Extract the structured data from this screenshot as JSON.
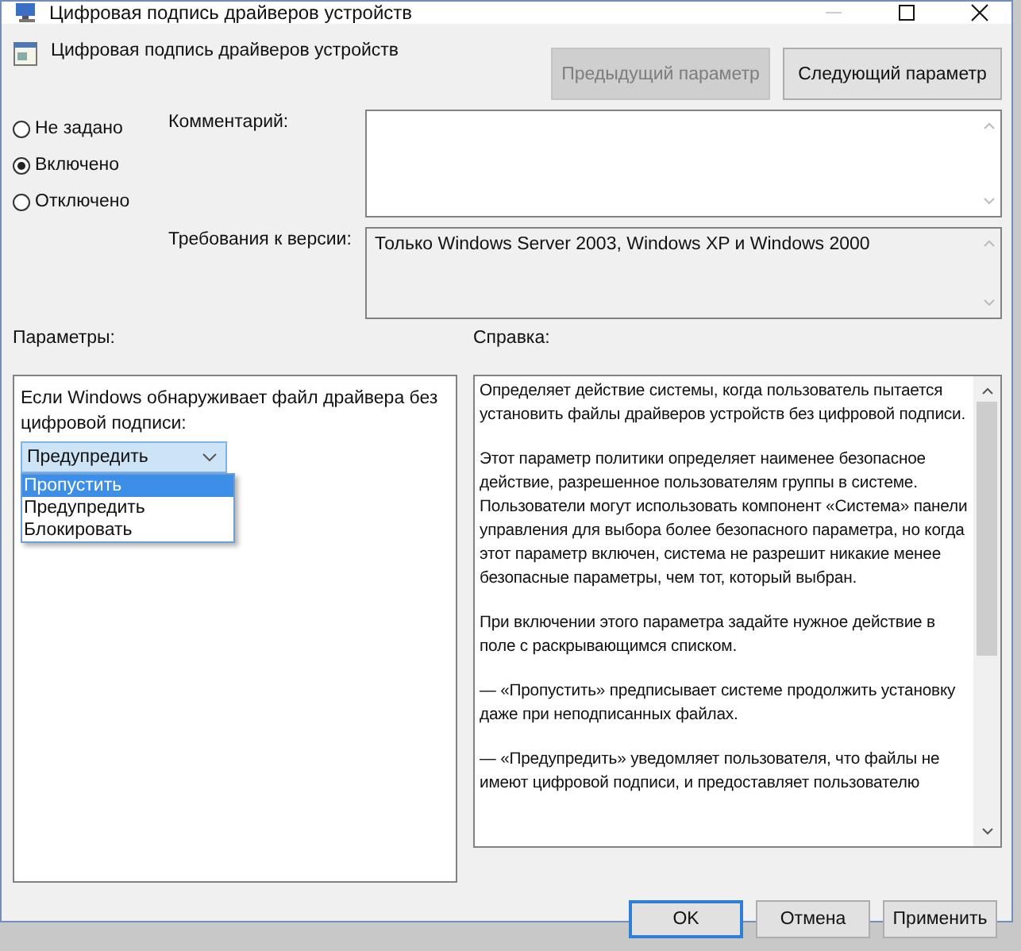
{
  "window": {
    "title": "Цифровая подпись драйверов устройств"
  },
  "header": {
    "title": "Цифровая подпись драйверов устройств"
  },
  "nav_buttons": [
    {
      "label": "Предыдущий параметр",
      "disabled": true
    },
    {
      "label": "Следующий параметр",
      "disabled": false
    }
  ],
  "state_options": [
    {
      "label": "Не задано",
      "selected": false
    },
    {
      "label": "Включено",
      "selected": true
    },
    {
      "label": "Отключено",
      "selected": false
    }
  ],
  "comment": {
    "label": "Комментарий:"
  },
  "version": {
    "label": "Требования к версии:",
    "value": "Только Windows Server 2003, Windows XP и Windows 2000"
  },
  "parameters": {
    "label": "Параметры:",
    "prompt": "Если Windows обнаруживает файл драйвера без цифровой подписи:",
    "dropdown": {
      "value": "Предупредить",
      "expanded": true,
      "options": [
        {
          "label": "Пропустить",
          "highlighted": true
        },
        {
          "label": "Предупредить",
          "highlighted": false
        },
        {
          "label": "Блокировать",
          "highlighted": false
        }
      ]
    }
  },
  "help": {
    "label": "Справка:",
    "paragraphs": [
      "Определяет действие системы, когда пользователь пытается установить файлы драйверов устройств без цифровой подписи.",
      "Этот параметр политики определяет наименее безопасное действие, разрешенное пользователям группы в системе. Пользователи могут использовать компонент «Система» панели управления для выбора более безопасного параметра, но когда этот параметр включен, система не разрешит никакие менее безопасные параметры, чем тот, который выбран.",
      "При включении этого параметра задайте нужное действие в поле с раскрывающимся списком.",
      "— «Пропустить» предписывает системе продолжить установку даже при неподписанных файлах.",
      "— «Предупредить» уведомляет пользователя, что файлы не имеют цифровой подписи, и предоставляет пользователю"
    ]
  },
  "footer_buttons": [
    {
      "label": "OK",
      "default": true
    },
    {
      "label": "Отмена",
      "default": false
    },
    {
      "label": "Применить",
      "default": false
    }
  ]
}
